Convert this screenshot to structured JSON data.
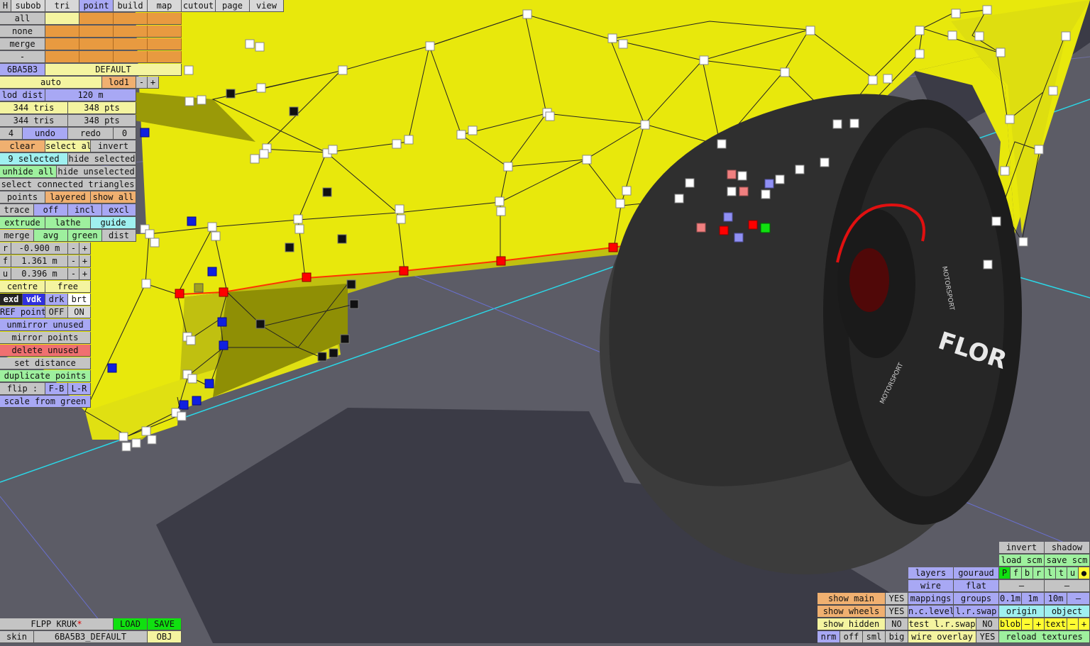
{
  "tabs": {
    "h": "H",
    "subob": "subob",
    "tri": "tri",
    "point": "point",
    "build": "build",
    "map": "map",
    "cutout": "cutout",
    "page": "page",
    "view": "view"
  },
  "left": {
    "all": "all",
    "none": "none",
    "merge": "merge",
    "dash": "-",
    "material_code": "6BA5B3",
    "material_name": "DEFAULT",
    "auto": "auto",
    "lod1": "lod1",
    "minus": "-",
    "plus": "+",
    "lod_dist_label": "lod dist",
    "lod_dist_value": "120 m",
    "tris1": "344 tris",
    "pts1": "348 pts",
    "tris2": "344 tris",
    "pts2": "348 pts",
    "undo_count": "4",
    "undo": "undo",
    "redo": "redo",
    "redo_count": "0",
    "clear": "clear",
    "select_all": "select all",
    "invert": "invert",
    "selected": "9 selected",
    "hide_selected": "hide selected",
    "unhide_all": "unhide all",
    "hide_unselected": "hide unselected",
    "select_connected": "select connected triangles",
    "points": "points",
    "layered": "layered",
    "show_all": "show all",
    "trace": "trace",
    "off": "off",
    "incl": "incl",
    "excl": "excl",
    "extrude": "extrude",
    "lathe": "lathe",
    "guide": "guide",
    "merge2": "merge",
    "avg": "avg",
    "green": "green",
    "dist": "dist",
    "r_label": "r",
    "r_value": "-0.900 m",
    "f_label": "f",
    "f_value": "1.361 m",
    "u_label": "u",
    "u_value": "0.396 m",
    "centre": "centre",
    "free": "free",
    "exd": "exd",
    "vdk": "vdk",
    "drk": "drk",
    "brt": "brt",
    "ref_points": "REF points",
    "ref_off": "OFF",
    "ref_on": "ON",
    "unmirror": "unmirror unused",
    "mirror": "mirror points",
    "delete_unused": "delete unused",
    "set_distance": "set distance",
    "duplicate": "duplicate points",
    "flip": "flip :",
    "fb": "F-B",
    "lr": "L-R",
    "scale_green": "scale from green"
  },
  "bottom_left": {
    "project": "FLPP KRUK",
    "modified_mark": "*",
    "load": "LOAD",
    "save": "SAVE",
    "skin": "skin",
    "skin_name": "6BA5B3_DEFAULT",
    "obj": "OBJ"
  },
  "bottom_right": {
    "invert": "invert",
    "shadow": "shadow",
    "load_scm": "load scm",
    "save_scm": "save scm",
    "letters": [
      "P",
      "f",
      "b",
      "r",
      "l",
      "t",
      "u",
      "●"
    ],
    "layers": "layers",
    "gouraud": "gouraud",
    "wire": "wire",
    "flat": "flat",
    "dash1": "–",
    "dash2": "–",
    "mappings": "mappings",
    "groups": "groups",
    "d01": "0.1m",
    "d1": "1m",
    "d10": "10m",
    "dminus": "–",
    "show_main": "show main",
    "show_main_v": "YES",
    "show_wheels": "show wheels",
    "show_wheels_v": "YES",
    "show_hidden": "show hidden",
    "show_hidden_v": "NO",
    "nclevel": "n.c.level",
    "lrswap": "l.r.swap",
    "origin": "origin",
    "object": "object",
    "test_lrswap": "test l.r.swap",
    "test_lrswap_v": "NO",
    "blob": "blob",
    "text": "text",
    "minus": "–",
    "plus": "+",
    "nrm": "nrm",
    "off": "off",
    "sml": "sml",
    "big": "big",
    "wire_overlay": "wire overlay",
    "wire_overlay_v": "YES",
    "reload": "reload textures"
  },
  "tire": {
    "brand": "FLOR",
    "rim_text": "MOTORSPORT"
  },
  "colors": {
    "mesh": "#e8e80c",
    "mesh_dark": "#8a8a05",
    "ground": "#5c5c66",
    "shadow": "#3a3a45",
    "tire": "#3a3a3a",
    "selected": "#ff0000",
    "green_point": "#10e010",
    "blue_point": "#1020e0"
  }
}
